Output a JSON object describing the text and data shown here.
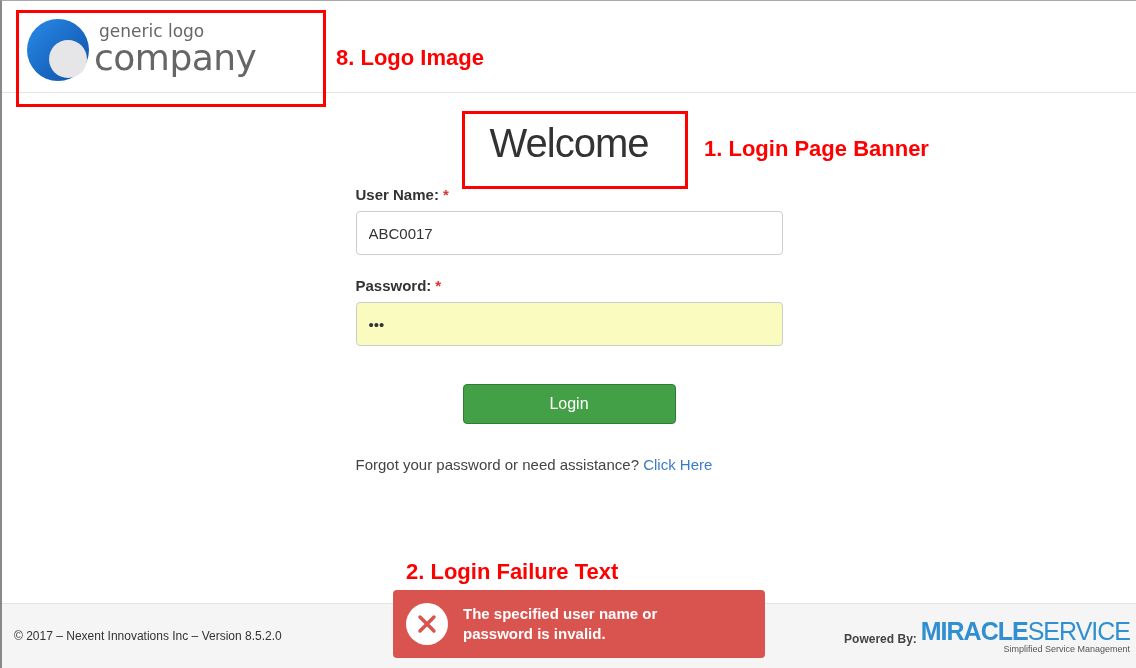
{
  "header": {
    "logo": {
      "line_1": "generic logo",
      "line_2": "company"
    }
  },
  "banner": {
    "title": "Welcome"
  },
  "form": {
    "fields": [
      {
        "label": "User Name:",
        "required_mark": "*",
        "value": "ABC0017",
        "autofilled": false
      },
      {
        "label": "Password:",
        "required_mark": "*",
        "value": "•••",
        "autofilled": true
      }
    ],
    "submit": "Login",
    "help_text": "Forgot your password or need assistance?",
    "help_link": "Click Here"
  },
  "footer": {
    "copyright": "© 2017 – Nexent Innovations Inc – Version 8.5.2.0",
    "powered_by": "Powered By:",
    "brand_bold": "MIRACLE",
    "brand_light": "SERVICE",
    "tagline": "Simplified Service Management"
  },
  "toast": {
    "message": "The specified user name or password is invalid."
  },
  "annotations": [
    {
      "label": "8. Logo Image",
      "kind": "framed"
    },
    {
      "label": "1. Login Page Banner",
      "kind": "framed"
    },
    {
      "label": "2. Login Failure Text",
      "kind": "plain"
    }
  ]
}
